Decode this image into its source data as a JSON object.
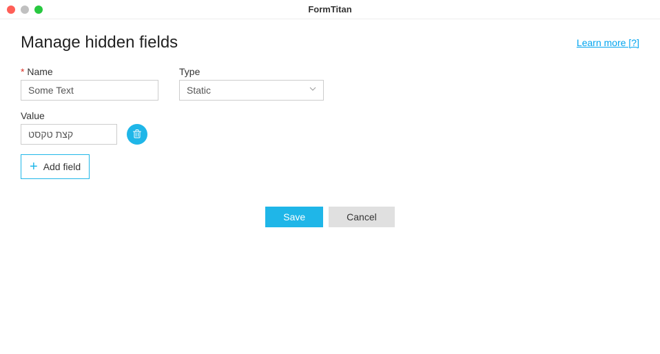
{
  "window": {
    "title": "FormTitan"
  },
  "header": {
    "title": "Manage hidden fields",
    "learn_more": "Learn more [?]"
  },
  "labels": {
    "name": "Name",
    "type": "Type",
    "value": "Value"
  },
  "fields": {
    "name_value": "Some Text",
    "type_selected": "Static",
    "value_value": "קצת טקסט"
  },
  "buttons": {
    "add_field": "Add field",
    "save": "Save",
    "cancel": "Cancel"
  }
}
